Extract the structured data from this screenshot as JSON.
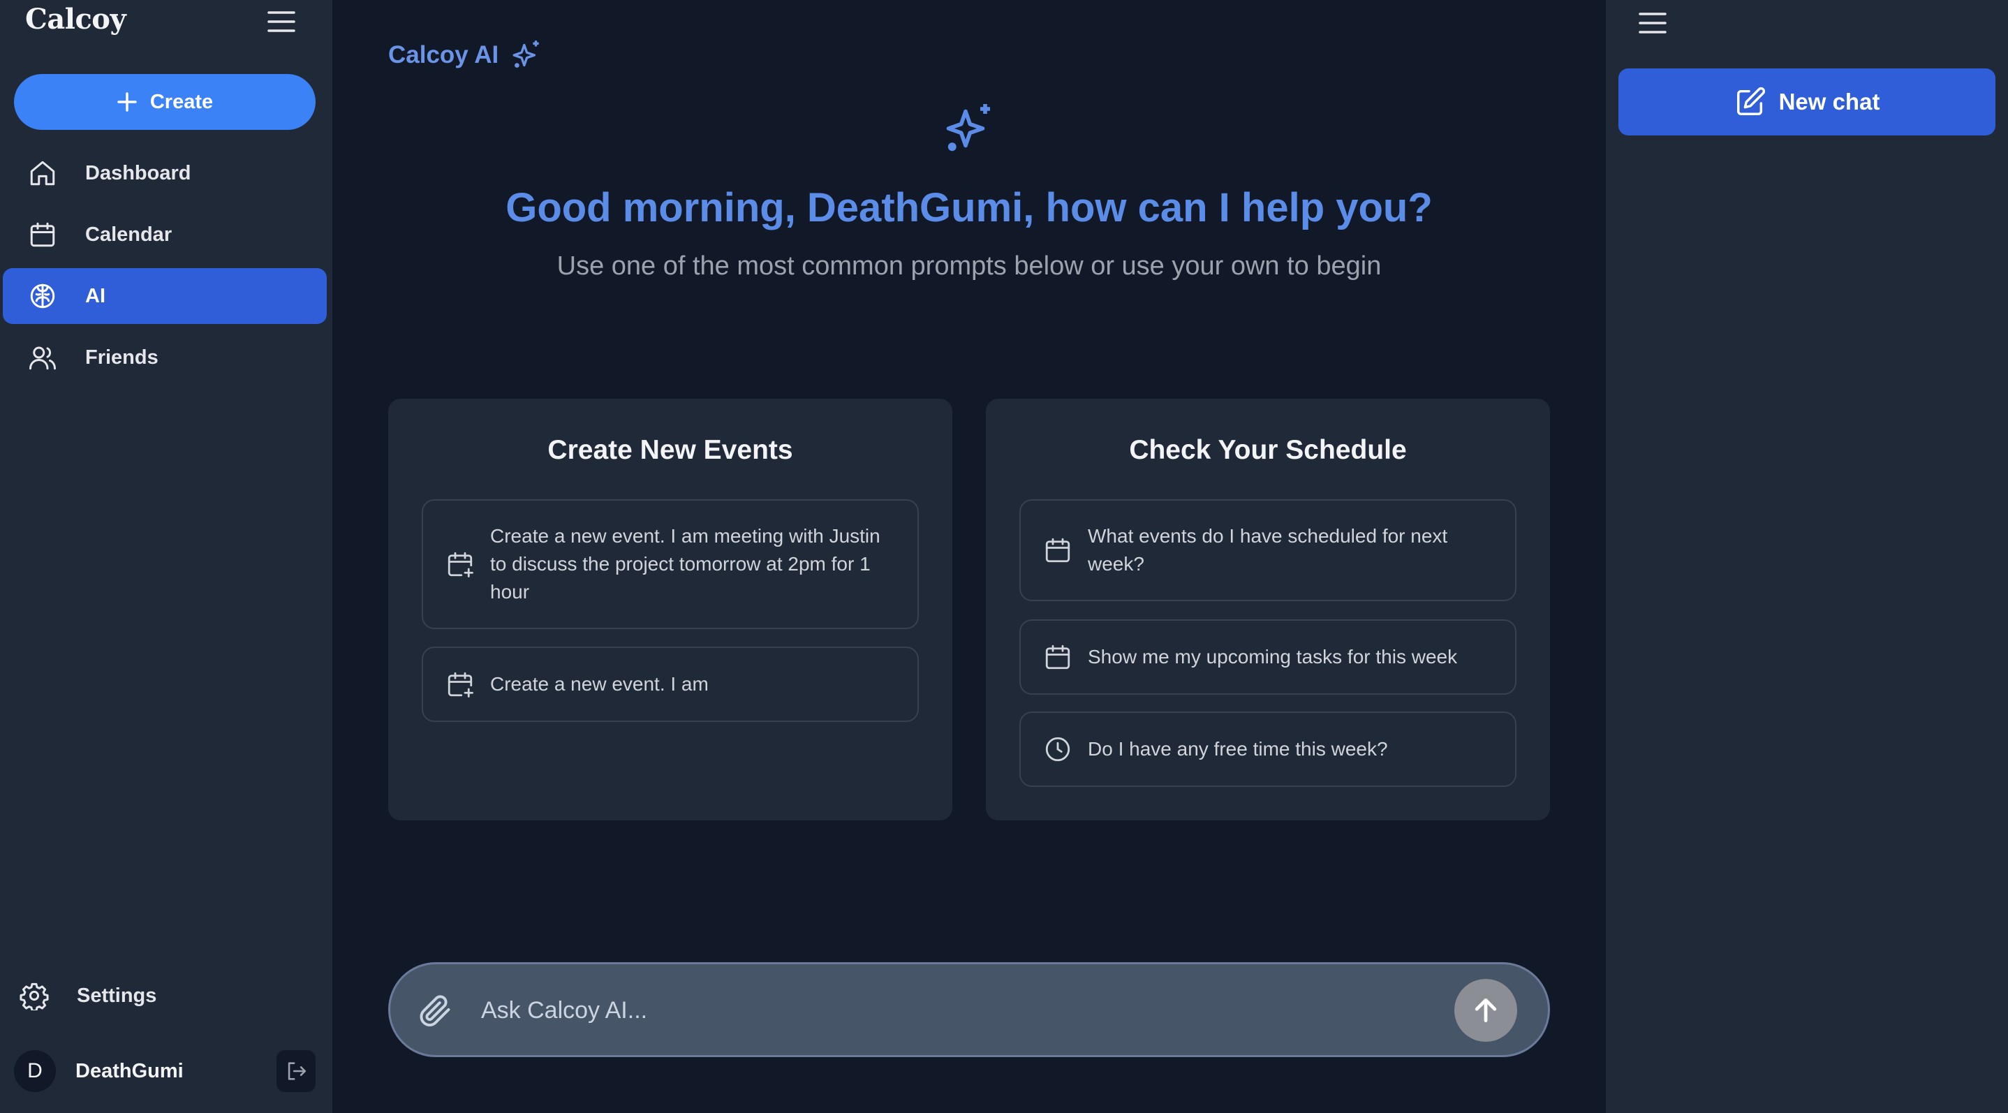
{
  "sidebar": {
    "brand": "Calcoy",
    "create_label": "Create",
    "nav": [
      {
        "label": "Dashboard",
        "icon": "home-icon"
      },
      {
        "label": "Calendar",
        "icon": "calendar-icon"
      },
      {
        "label": "AI",
        "icon": "brain-icon",
        "active": true
      },
      {
        "label": "Friends",
        "icon": "users-icon"
      }
    ],
    "settings_label": "Settings",
    "user": {
      "initial": "D",
      "name": "DeathGumi"
    }
  },
  "main": {
    "title": "Calcoy AI",
    "greeting": "Good morning, DeathGumi, how can I help you?",
    "subtitle": "Use one of the most common prompts below or use your own to begin",
    "cards": [
      {
        "title": "Create New Events",
        "prompts": [
          {
            "text": "Create a new event. I am meeting with Justin to discuss the project tomorrow at 2pm for 1 hour",
            "icon": "calendar-plus-icon"
          },
          {
            "text": "Create a new event. I am",
            "icon": "calendar-plus-icon"
          }
        ]
      },
      {
        "title": "Check Your Schedule",
        "prompts": [
          {
            "text": "What events do I have scheduled for next week?",
            "icon": "calendar-icon"
          },
          {
            "text": "Show me my upcoming tasks for this week",
            "icon": "calendar-icon"
          },
          {
            "text": "Do I have any free time this week?",
            "icon": "clock-icon"
          }
        ]
      }
    ],
    "input": {
      "placeholder": "Ask Calcoy AI..."
    }
  },
  "right_panel": {
    "new_chat_label": "New chat"
  },
  "colors": {
    "accent": "#3b82f6",
    "active": "#2f5ed8",
    "heading": "#5b8de8",
    "background": "#111827",
    "panel": "#1f2937"
  }
}
